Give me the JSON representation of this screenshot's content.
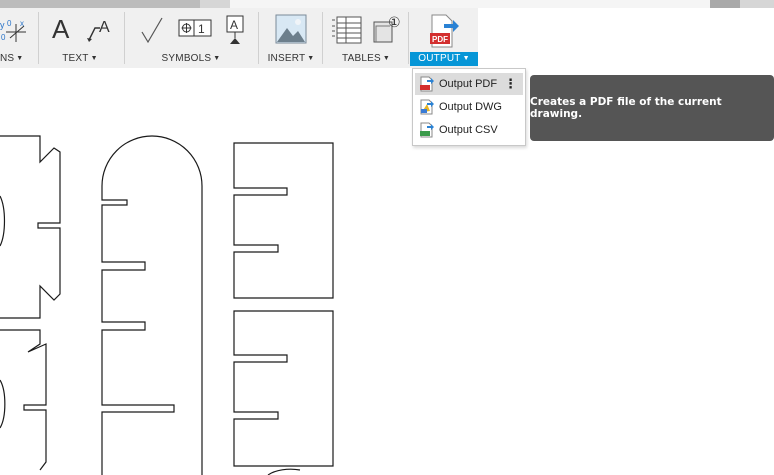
{
  "toolbar": {
    "groups": [
      {
        "label": "NS",
        "icon": "dimensions-icon"
      },
      {
        "label": "TEXT",
        "icon": "text-icon"
      },
      {
        "label": "SYMBOLS",
        "icon": "symbols-icon"
      },
      {
        "label": "INSERT",
        "icon": "insert-image-icon"
      },
      {
        "label": "TABLES",
        "icon": "table-icon"
      },
      {
        "label": "OUTPUT",
        "icon": "pdf-output-icon"
      }
    ],
    "text_icon_glyph": "A",
    "symbols_datum_glyph": "A",
    "symbols_fcf_glyph": "1",
    "tables_balloon_glyph": "①",
    "pdf_glyph": "PDF",
    "accent_color": "#0696d7"
  },
  "output_menu": {
    "items": [
      {
        "label": "Output PDF",
        "icon": "pdf-file-icon",
        "hovered": true
      },
      {
        "label": "Output DWG",
        "icon": "dwg-file-icon",
        "hovered": false
      },
      {
        "label": "Output CSV",
        "icon": "csv-file-icon",
        "hovered": false
      }
    ],
    "more_glyph": "⋮"
  },
  "tooltip": {
    "text": "Creates a PDF file of the current drawing."
  }
}
